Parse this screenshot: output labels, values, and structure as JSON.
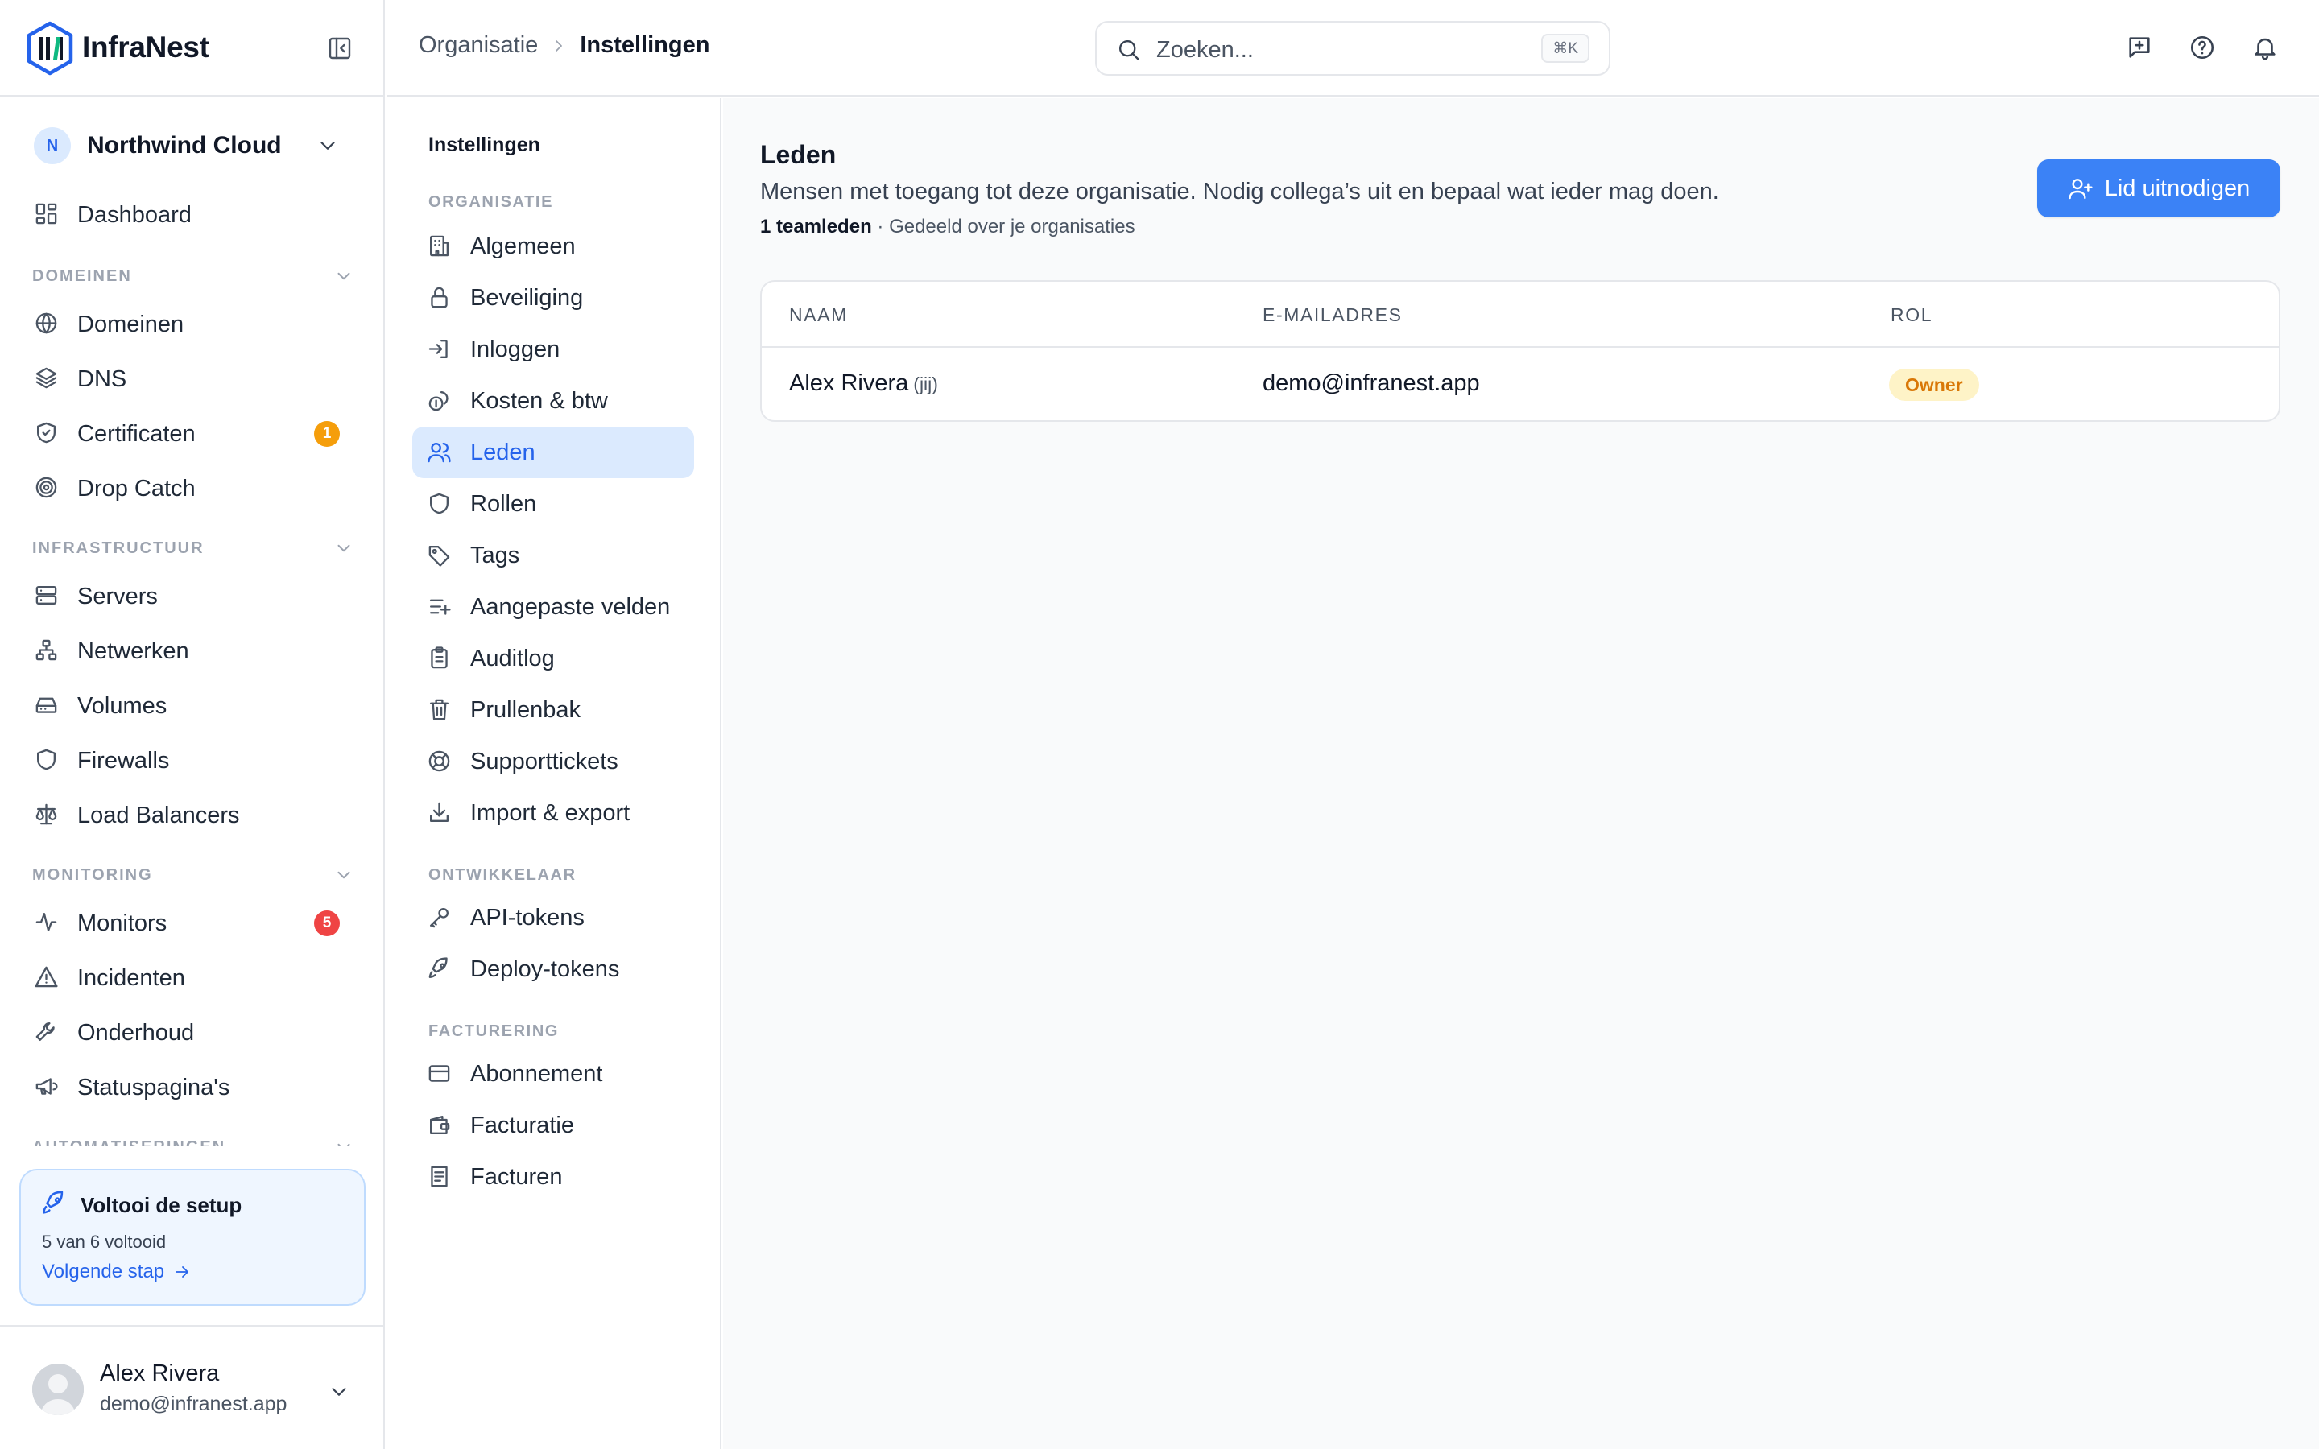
{
  "app": {
    "name": "InfraNest",
    "brand_color": "#2563eb"
  },
  "org": {
    "initial": "N",
    "name": "Northwind Cloud"
  },
  "sidebar": {
    "dashboard": "Dashboard",
    "sections": {
      "domains": "DOMEINEN",
      "infra": "INFRASTRUCTUUR",
      "monitoring": "MONITORING",
      "automation": "AUTOMATISERINGEN"
    },
    "items": {
      "domains": "Domeinen",
      "dns": "DNS",
      "certificates": "Certificaten",
      "certificates_badge": "1",
      "dropcatch": "Drop Catch",
      "servers": "Servers",
      "networks": "Netwerken",
      "volumes": "Volumes",
      "firewalls": "Firewalls",
      "loadbalancers": "Load Balancers",
      "monitors": "Monitors",
      "monitors_badge": "5",
      "incidents": "Incidenten",
      "maintenance": "Onderhoud",
      "statuspages": "Statuspagina's"
    },
    "badge_colors": {
      "warning": "#f59e0b",
      "danger": "#ef4444"
    }
  },
  "setup": {
    "title": "Voltooi de setup",
    "progress": "5 van 6 voltooid",
    "completed": 5,
    "total": 6,
    "next": "Volgende stap"
  },
  "user": {
    "name": "Alex Rivera",
    "email": "demo@infranest.app"
  },
  "topbar": {
    "breadcrumb": {
      "parent": "Organisatie",
      "current": "Instellingen"
    },
    "search_placeholder": "Zoeken...",
    "search_shortcut": "⌘K"
  },
  "settings_nav": {
    "title": "Instellingen",
    "sections": {
      "org": "ORGANISATIE",
      "dev": "ONTWIKKELAAR",
      "billing": "FACTURERING"
    },
    "items": {
      "general": "Algemeen",
      "security": "Beveiliging",
      "login": "Inloggen",
      "costs": "Kosten & btw",
      "members": "Leden",
      "roles": "Rollen",
      "tags": "Tags",
      "customfields": "Aangepaste velden",
      "auditlog": "Auditlog",
      "trash": "Prullenbak",
      "support": "Supporttickets",
      "importexport": "Import & export",
      "apitokens": "API-tokens",
      "deploytokens": "Deploy-tokens",
      "subscription": "Abonnement",
      "billing": "Facturatie",
      "invoices": "Facturen"
    },
    "active": "members"
  },
  "main": {
    "title": "Leden",
    "description": "Mensen met toegang tot deze organisatie. Nodig collega’s uit en bepaal wat ieder mag doen.",
    "member_count": "1 teamleden",
    "meta_suffix": " · Gedeeld over je organisaties",
    "invite_button": "Lid uitnodigen",
    "table": {
      "headers": {
        "name": "NAAM",
        "email": "E-MAILADRES",
        "role": "ROL"
      },
      "rows": [
        {
          "name": "Alex Rivera",
          "you": "(jij)",
          "email": "demo@infranest.app",
          "role": "Owner"
        }
      ]
    }
  }
}
